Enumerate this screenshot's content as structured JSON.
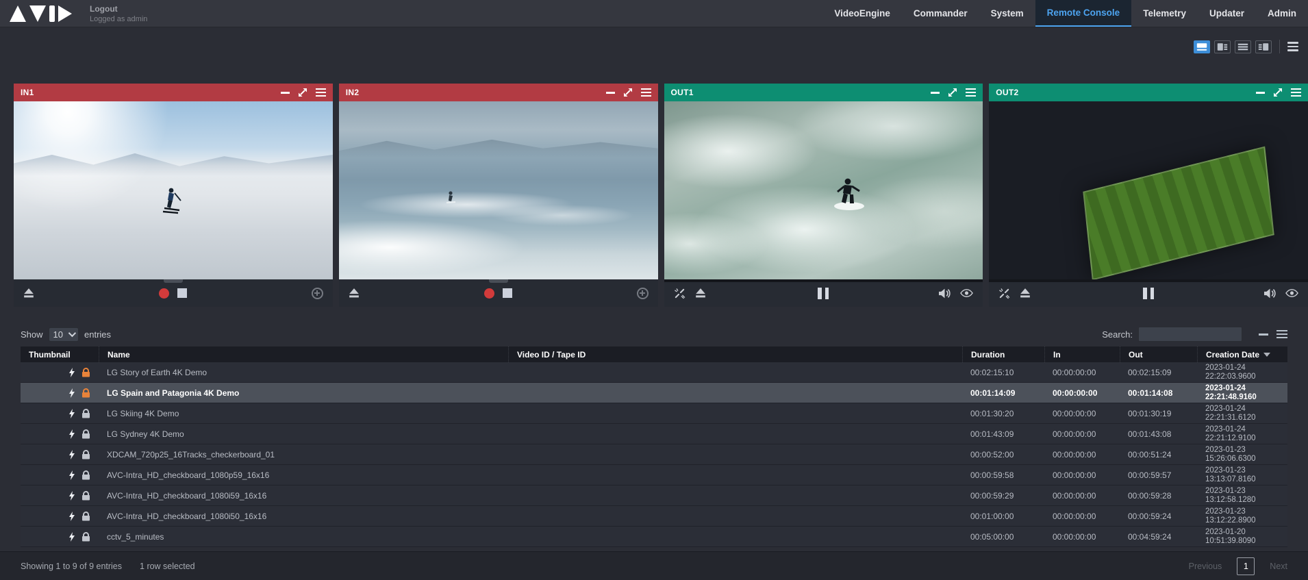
{
  "header": {
    "logout_label": "Logout",
    "logged_as": "Logged as admin",
    "nav_items": [
      {
        "label": "VideoEngine",
        "active": false
      },
      {
        "label": "Commander",
        "active": false
      },
      {
        "label": "System",
        "active": false
      },
      {
        "label": "Remote Console",
        "active": true
      },
      {
        "label": "Telemetry",
        "active": false
      },
      {
        "label": "Updater",
        "active": false
      },
      {
        "label": "Admin",
        "active": false
      }
    ]
  },
  "colors": {
    "accent_blue": "#4da4f0",
    "input_header_red": "#b23b43",
    "output_header_green": "#0d8e72",
    "progress_orange": "#e8832f",
    "lock_orange": "#e8833a",
    "lock_gray": "#c2c6ce",
    "record_red": "#d23b3b"
  },
  "viewbar": {
    "layout_buttons": [
      "layout-preview-top",
      "layout-preview-left",
      "layout-list-only",
      "layout-preview-right"
    ],
    "active_layout_index": 0,
    "menu_icon": "hamburger-icon"
  },
  "panels": [
    {
      "title": "IN1",
      "type": "input",
      "header_color": "#b23b43",
      "art": "ski",
      "controls": [
        "eject-icon",
        "record-button",
        "stop-button",
        "add-circle-icon"
      ],
      "progress_pct": null
    },
    {
      "title": "IN2",
      "type": "input",
      "header_color": "#b23b43",
      "art": "surf",
      "controls": [
        "eject-icon",
        "record-button",
        "stop-button",
        "add-circle-icon"
      ],
      "progress_pct": null
    },
    {
      "title": "OUT1",
      "type": "output",
      "header_color": "#0d8e72",
      "art": "foam",
      "controls": [
        "unlink-icon",
        "eject-icon",
        "pause-button",
        "volume-icon",
        "eye-icon"
      ],
      "progress_pct": 9
    },
    {
      "title": "OUT2",
      "type": "output",
      "header_color": "#0d8e72",
      "art": "stadium",
      "controls": [
        "unlink-icon",
        "eject-icon",
        "pause-button",
        "volume-icon",
        "eye-icon"
      ],
      "progress_pct": 5
    }
  ],
  "table": {
    "show_label": "Show",
    "page_size": "10",
    "entries_label": "entries",
    "search_label": "Search:",
    "search_value": "",
    "columns": [
      "Thumbnail",
      "Name",
      "Video ID / Tape ID",
      "Duration",
      "In",
      "Out",
      "Creation Date"
    ],
    "rows": [
      {
        "thumb": "earth",
        "name": "LG Story of Earth 4K Demo",
        "video_id": "",
        "duration": "00:02:15:10",
        "in": "00:00:00:00",
        "out": "00:02:15:09",
        "date": "2023-01-24",
        "time": "22:22:03.9600",
        "lock": "orange",
        "selected": false
      },
      {
        "thumb": "patagonia",
        "name": "LG Spain and Patagonia 4K Demo",
        "video_id": "",
        "duration": "00:01:14:09",
        "in": "00:00:00:00",
        "out": "00:01:14:08",
        "date": "2023-01-24",
        "time": "22:21:48.9160",
        "lock": "orange",
        "selected": true
      },
      {
        "thumb": "skiclouds",
        "name": "LG Skiing 4K Demo",
        "video_id": "",
        "duration": "00:01:30:20",
        "in": "00:00:00:00",
        "out": "00:01:30:19",
        "date": "2023-01-24",
        "time": "22:21:31.6120",
        "lock": "gray",
        "selected": false
      },
      {
        "thumb": "sydney",
        "name": "LG Sydney 4K Demo",
        "video_id": "",
        "duration": "00:01:43:09",
        "in": "00:00:00:00",
        "out": "00:01:43:08",
        "date": "2023-01-24",
        "time": "22:21:12.9100",
        "lock": "gray",
        "selected": false
      },
      {
        "thumb": "checker",
        "name": "XDCAM_720p25_16Tracks_checkerboard_01",
        "video_id": "",
        "duration": "00:00:52:00",
        "in": "00:00:00:00",
        "out": "00:00:51:24",
        "date": "2023-01-23",
        "time": "15:26:06.6300",
        "lock": "gray",
        "selected": false
      },
      {
        "thumb": "checkerdiag",
        "name": "AVC-Intra_HD_checkboard_1080p59_16x16",
        "video_id": "",
        "duration": "00:00:59:58",
        "in": "00:00:00:00",
        "out": "00:00:59:57",
        "date": "2023-01-23",
        "time": "13:13:07.8160",
        "lock": "gray",
        "selected": false
      },
      {
        "thumb": "checkerdiag",
        "name": "AVC-Intra_HD_checkboard_1080i59_16x16",
        "video_id": "",
        "duration": "00:00:59:29",
        "in": "00:00:00:00",
        "out": "00:00:59:28",
        "date": "2023-01-23",
        "time": "13:12:58.1280",
        "lock": "gray",
        "selected": false
      },
      {
        "thumb": "checkerdiag",
        "name": "AVC-Intra_HD_checkboard_1080i50_16x16",
        "video_id": "",
        "duration": "00:01:00:00",
        "in": "00:00:00:00",
        "out": "00:00:59:24",
        "date": "2023-01-23",
        "time": "13:12:22.8900",
        "lock": "gray",
        "selected": false
      },
      {
        "thumb": "cctv",
        "name": "cctv_5_minutes",
        "video_id": "",
        "duration": "00:05:00:00",
        "in": "00:00:00:00",
        "out": "00:04:59:24",
        "date": "2023-01-20",
        "time": "10:51:39.8090",
        "lock": "gray",
        "selected": false
      }
    ]
  },
  "footer": {
    "showing_text": "Showing 1 to 9 of 9 entries",
    "selected_text": "1 row selected",
    "previous_label": "Previous",
    "current_page": "1",
    "next_label": "Next"
  }
}
